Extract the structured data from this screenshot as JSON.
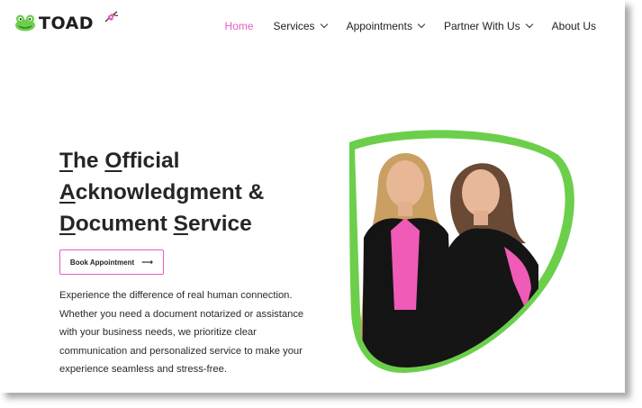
{
  "header": {
    "logo_text": "TOAD",
    "nav": [
      {
        "label": "Home",
        "active": true,
        "dropdown": false
      },
      {
        "label": "Services",
        "active": false,
        "dropdown": true
      },
      {
        "label": "Appointments",
        "active": false,
        "dropdown": true
      },
      {
        "label": "Partner With Us",
        "active": false,
        "dropdown": true
      },
      {
        "label": "About Us",
        "active": false,
        "dropdown": false
      }
    ]
  },
  "hero": {
    "title_lines": [
      {
        "first": "T",
        "rest": "he ",
        "first2": "O",
        "rest2": "fficial"
      },
      {
        "first": "A",
        "rest": "cknowledgment &",
        "first2": "",
        "rest2": ""
      },
      {
        "first": "D",
        "rest": "ocument ",
        "first2": "S",
        "rest2": "ervice"
      }
    ],
    "cta_label": "Book Appointment",
    "cta_icon": "arrow-right-icon",
    "description": "Experience the difference of real human connection. Whether you need a document notarized or assistance with your business needs, we prioritize clear communication and personalized service to make your experience seamless and stress-free."
  },
  "colors": {
    "accent_pink": "#e85cc4",
    "accent_green": "#6ccf4b",
    "text_dark": "#262626"
  }
}
